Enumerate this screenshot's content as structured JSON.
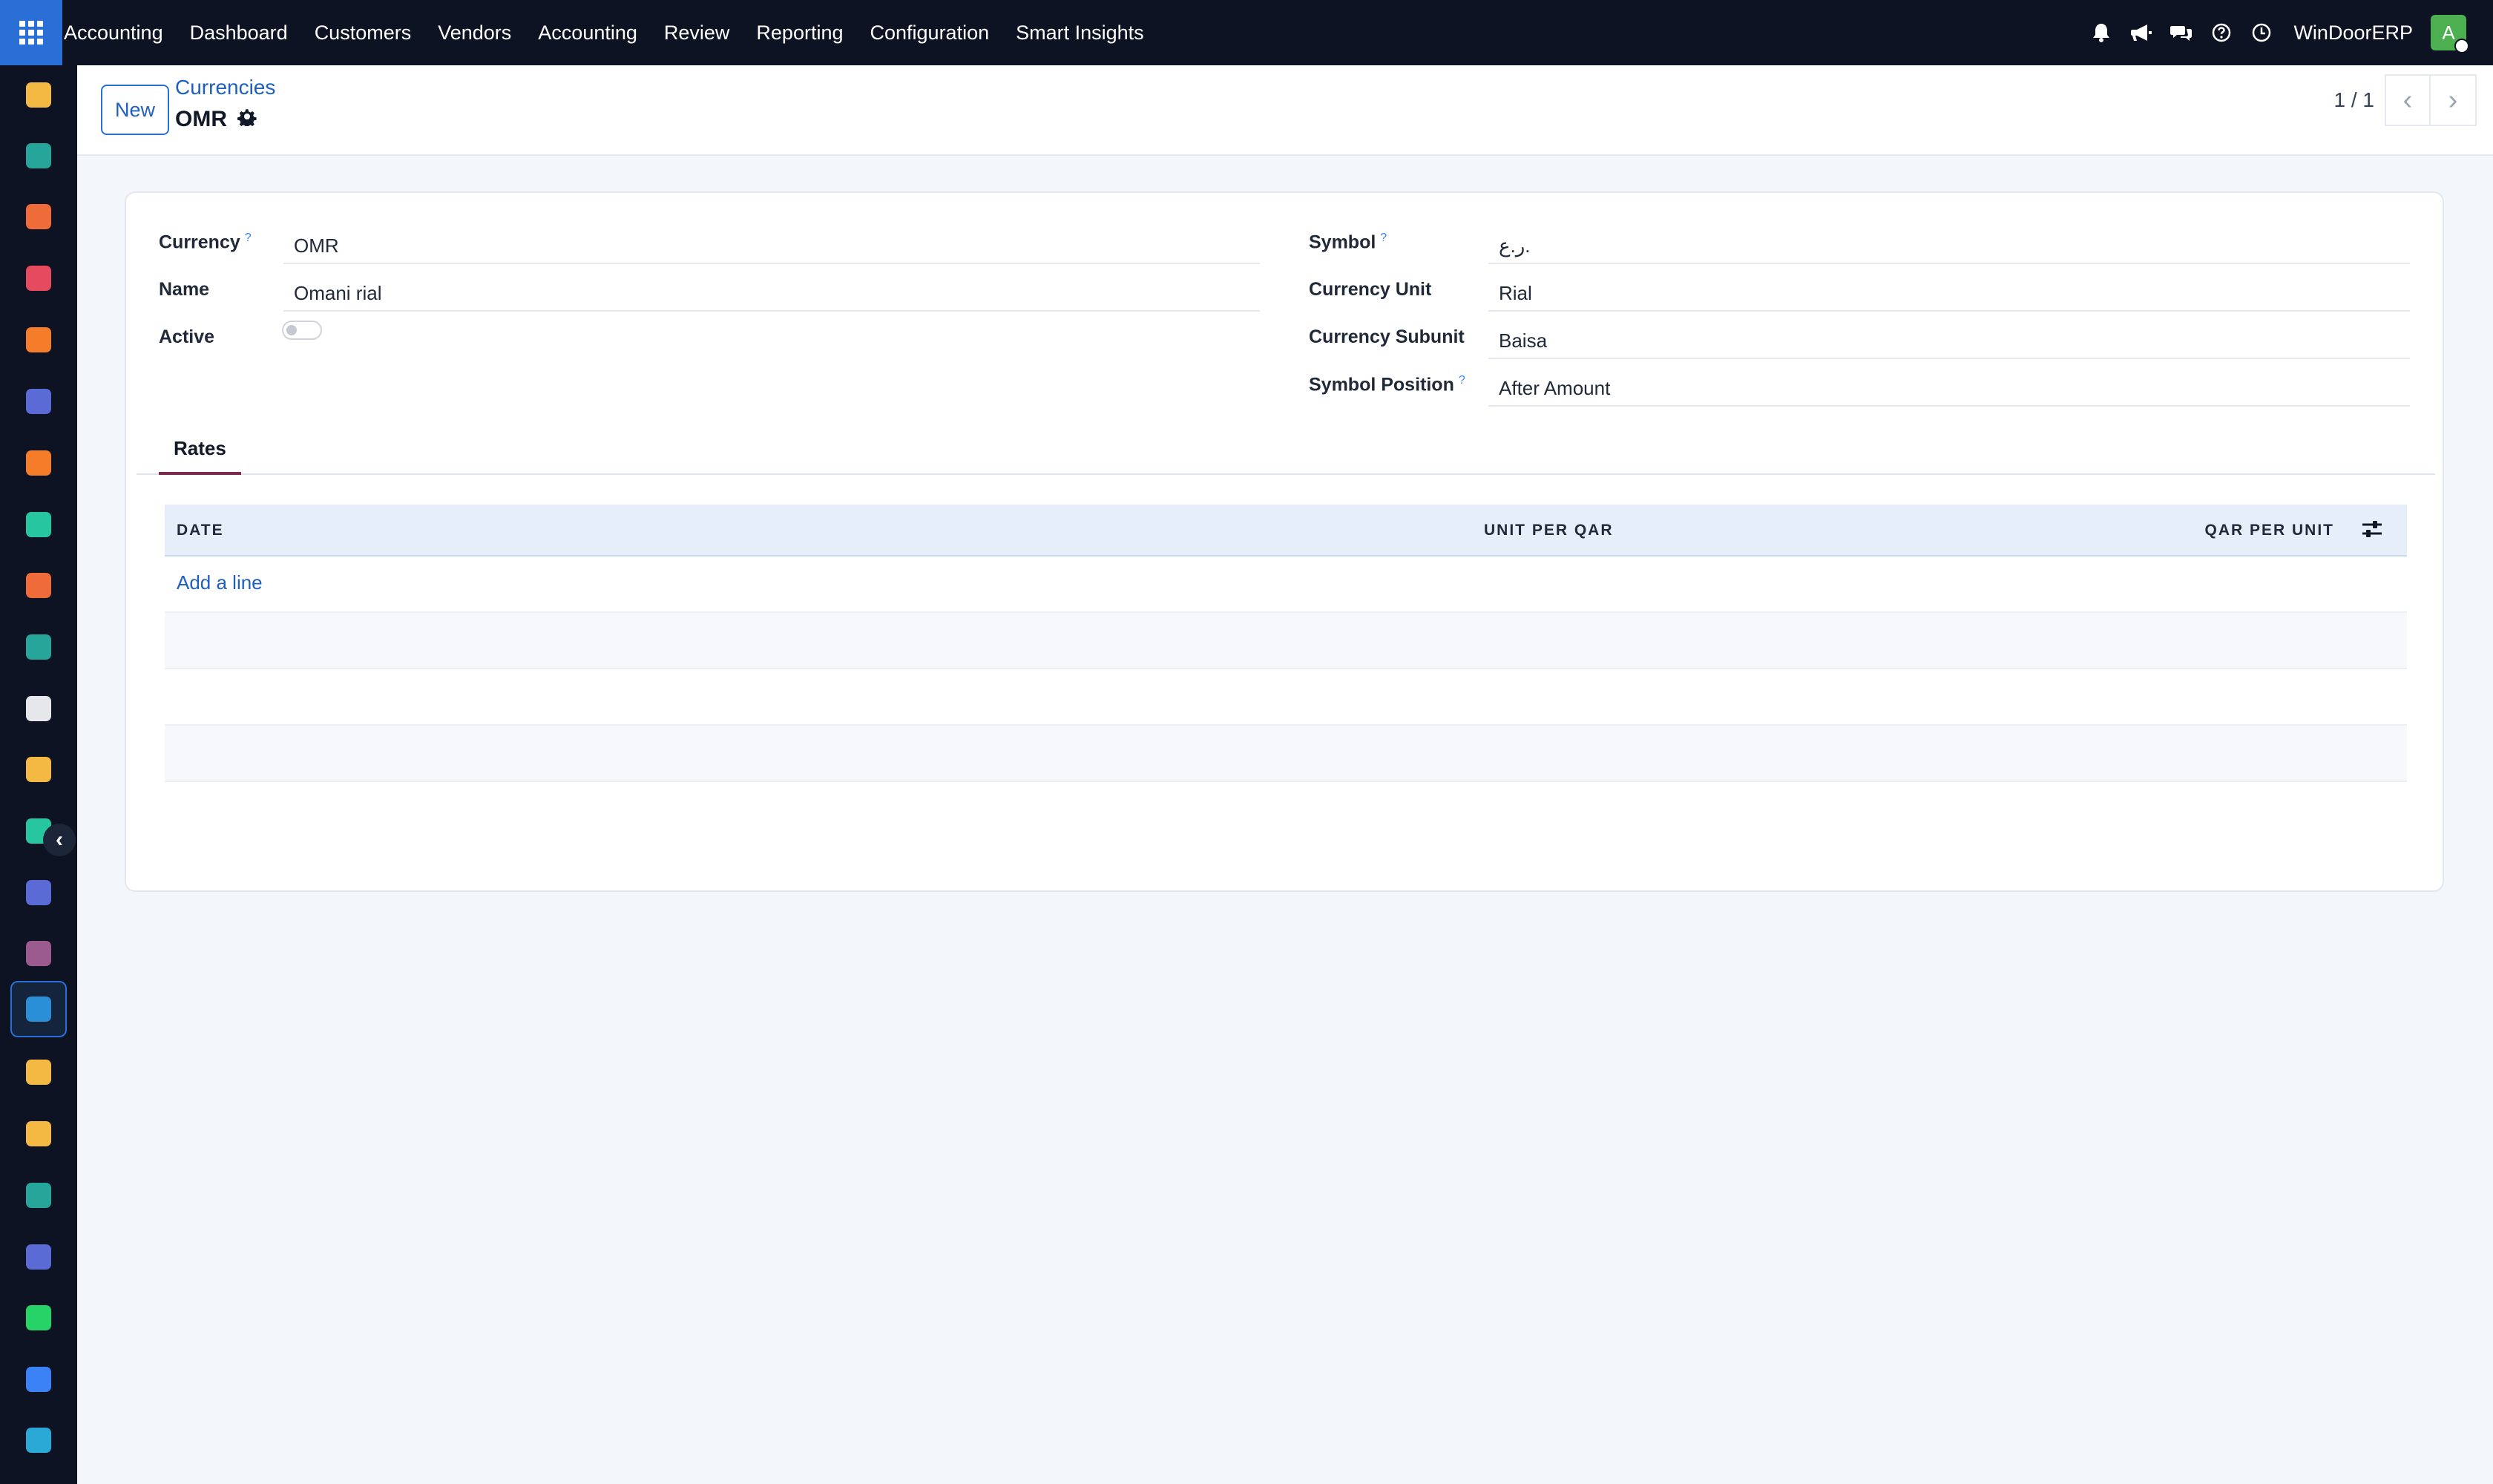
{
  "topbar": {
    "app_name": "Accounting",
    "menu": [
      "Dashboard",
      "Customers",
      "Vendors",
      "Accounting",
      "Review",
      "Reporting",
      "Configuration",
      "Smart Insights"
    ],
    "company": "WinDoorERP",
    "avatar_letter": "A"
  },
  "sidebar": {
    "apps": [
      {
        "name": "app-1-icon",
        "color": "#f4b942"
      },
      {
        "name": "contacts-icon",
        "color": "#26a69a"
      },
      {
        "name": "sales-chart-icon",
        "color": "#ef6c3a"
      },
      {
        "name": "pie-app-icon",
        "color": "#e64a5f"
      },
      {
        "name": "chat-bubble-icon",
        "color": "#f57c29"
      },
      {
        "name": "mail-icon",
        "color": "#5b6bd6"
      },
      {
        "name": "discuss-icon",
        "color": "#f57c29"
      },
      {
        "name": "inventory-icon",
        "color": "#26c6a0"
      },
      {
        "name": "reporting-icon",
        "color": "#ef6c3a"
      },
      {
        "name": "employees-icon",
        "color": "#26a69a"
      },
      {
        "name": "product-box-icon",
        "color": "#e5e7eb"
      },
      {
        "name": "sign-icon",
        "color": "#f4b942"
      },
      {
        "name": "todo-check-icon",
        "color": "#26c6a0"
      },
      {
        "name": "knowledge-icon",
        "color": "#5b6bd6"
      },
      {
        "name": "purchase-icon",
        "color": "#9c5b8f"
      },
      {
        "name": "accounting-dollar-icon",
        "color": "#2a8fd6"
      },
      {
        "name": "team-icon",
        "color": "#f4b942"
      },
      {
        "name": "calendar-icon",
        "color": "#f4b942"
      },
      {
        "name": "pen-icon",
        "color": "#26a69a"
      },
      {
        "name": "dashboard-tiles-icon",
        "color": "#5b6bd6"
      },
      {
        "name": "whatsapp-icon",
        "color": "#25d366"
      },
      {
        "name": "timer-icon",
        "color": "#3b82f6"
      },
      {
        "name": "wave-app-icon",
        "color": "#2aa8d6"
      }
    ]
  },
  "control": {
    "new_label": "New",
    "breadcrumb": "Currencies",
    "record_title": "OMR",
    "pager": "1 / 1"
  },
  "form": {
    "left": {
      "currency_label": "Currency",
      "currency_value": "OMR",
      "name_label": "Name",
      "name_value": "Omani rial",
      "active_label": "Active",
      "active": false
    },
    "right": {
      "symbol_label": "Symbol",
      "symbol_value": "ر.ع.",
      "unit_label": "Currency Unit",
      "unit_value": "Rial",
      "subunit_label": "Currency Subunit",
      "subunit_value": "Baisa",
      "position_label": "Symbol Position",
      "position_value": "After Amount"
    },
    "help_mark": "?"
  },
  "tabs": {
    "rates": "Rates"
  },
  "rates_table": {
    "columns": [
      "DATE",
      "UNIT PER QAR",
      "QAR PER UNIT"
    ],
    "add_line": "Add a line"
  }
}
